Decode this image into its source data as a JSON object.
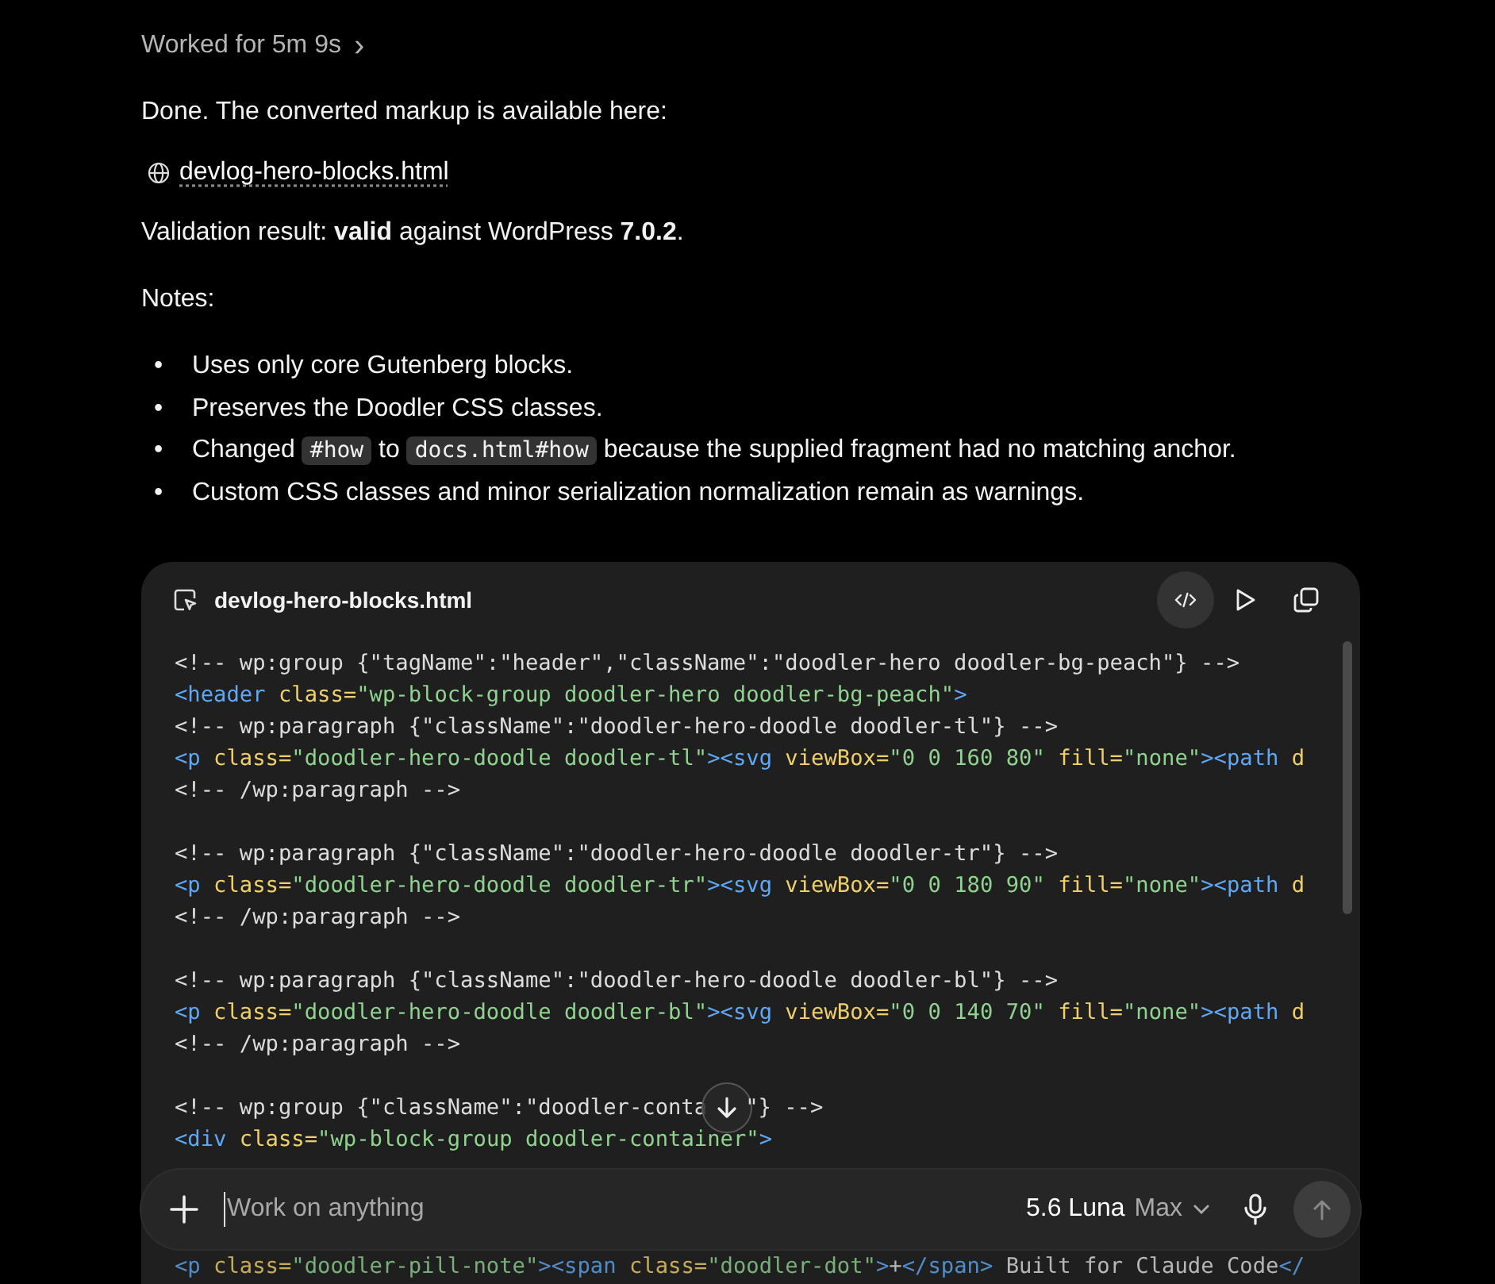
{
  "status": {
    "label": "Worked for 5m 9s",
    "chevron": "›"
  },
  "message": {
    "intro": "Done. The converted markup is available here:",
    "link": "devlog-hero-blocks.html",
    "validation": "Validation result: **valid** against WordPress **7.0.2**.",
    "notes_label": "Notes:",
    "notes": [
      {
        "bullet": "•",
        "parts": [
          {
            "kind": "text",
            "text": "Uses only core Gutenberg blocks."
          }
        ]
      },
      {
        "bullet": "•",
        "parts": [
          {
            "kind": "text",
            "text": "Preserves the Doodler CSS classes."
          }
        ]
      },
      {
        "bullet": "•",
        "parts": [
          {
            "kind": "text",
            "text": "Changed "
          },
          {
            "kind": "code",
            "text": "#how"
          },
          {
            "kind": "text",
            "text": " to "
          },
          {
            "kind": "code",
            "text": "docs.html#how"
          },
          {
            "kind": "text",
            "text": " because the supplied fragment had no matching anchor."
          }
        ]
      },
      {
        "bullet": "•",
        "parts": [
          {
            "kind": "text",
            "text": "Custom CSS classes and minor serialization normalization remain as warnings."
          }
        ]
      }
    ]
  },
  "code_card": {
    "filename": "devlog-hero-blocks.html",
    "lines": [
      {
        "kind": "code",
        "tokens": [
          {
            "kind": "comment",
            "text": "<!-- wp:group {\"tagName\":\"header\",\"className\":\"doodler-hero doodler-bg-peach\"} -->"
          }
        ]
      },
      {
        "kind": "code",
        "tokens": [
          {
            "kind": "tag",
            "text": "<header"
          },
          {
            "kind": "attr",
            "text": " class="
          },
          {
            "kind": "string",
            "text": "\"wp-block-group doodler-hero doodler-bg-peach\""
          },
          {
            "kind": "tag",
            "text": ">"
          }
        ]
      },
      {
        "kind": "code",
        "tokens": [
          {
            "kind": "comment",
            "text": "<!-- wp:paragraph {\"className\":\"doodler-hero-doodle doodler-tl\"} -->"
          }
        ]
      },
      {
        "kind": "code",
        "tokens": [
          {
            "kind": "tag",
            "text": "<p"
          },
          {
            "kind": "attr",
            "text": " class="
          },
          {
            "kind": "string",
            "text": "\"doodler-hero-doodle doodler-tl\""
          },
          {
            "kind": "tag",
            "text": "><svg"
          },
          {
            "kind": "attr",
            "text": " viewBox="
          },
          {
            "kind": "string",
            "text": "\"0 0 160 80\""
          },
          {
            "kind": "attr",
            "text": " fill="
          },
          {
            "kind": "string",
            "text": "\"none\""
          },
          {
            "kind": "tag",
            "text": "><path"
          },
          {
            "kind": "attr",
            "text": " d"
          }
        ]
      },
      {
        "kind": "code",
        "tokens": [
          {
            "kind": "comment",
            "text": "<!-- /wp:paragraph -->"
          }
        ]
      },
      {
        "kind": "blank"
      },
      {
        "kind": "code",
        "tokens": [
          {
            "kind": "comment",
            "text": "<!-- wp:paragraph {\"className\":\"doodler-hero-doodle doodler-tr\"} -->"
          }
        ]
      },
      {
        "kind": "code",
        "tokens": [
          {
            "kind": "tag",
            "text": "<p"
          },
          {
            "kind": "attr",
            "text": " class="
          },
          {
            "kind": "string",
            "text": "\"doodler-hero-doodle doodler-tr\""
          },
          {
            "kind": "tag",
            "text": "><svg"
          },
          {
            "kind": "attr",
            "text": " viewBox="
          },
          {
            "kind": "string",
            "text": "\"0 0 180 90\""
          },
          {
            "kind": "attr",
            "text": " fill="
          },
          {
            "kind": "string",
            "text": "\"none\""
          },
          {
            "kind": "tag",
            "text": "><path"
          },
          {
            "kind": "attr",
            "text": " d"
          }
        ]
      },
      {
        "kind": "code",
        "tokens": [
          {
            "kind": "comment",
            "text": "<!-- /wp:paragraph -->"
          }
        ]
      },
      {
        "kind": "blank"
      },
      {
        "kind": "code",
        "tokens": [
          {
            "kind": "comment",
            "text": "<!-- wp:paragraph {\"className\":\"doodler-hero-doodle doodler-bl\"} -->"
          }
        ]
      },
      {
        "kind": "code",
        "tokens": [
          {
            "kind": "tag",
            "text": "<p"
          },
          {
            "kind": "attr",
            "text": " class="
          },
          {
            "kind": "string",
            "text": "\"doodler-hero-doodle doodler-bl\""
          },
          {
            "kind": "tag",
            "text": "><svg"
          },
          {
            "kind": "attr",
            "text": " viewBox="
          },
          {
            "kind": "string",
            "text": "\"0 0 140 70\""
          },
          {
            "kind": "attr",
            "text": " fill="
          },
          {
            "kind": "string",
            "text": "\"none\""
          },
          {
            "kind": "tag",
            "text": "><path"
          },
          {
            "kind": "attr",
            "text": " d"
          }
        ]
      },
      {
        "kind": "code",
        "tokens": [
          {
            "kind": "comment",
            "text": "<!-- /wp:paragraph -->"
          }
        ]
      },
      {
        "kind": "blank"
      },
      {
        "kind": "code",
        "tokens": [
          {
            "kind": "comment",
            "text": "<!-- wp:group {\"className\":\"doodler-conta"
          },
          {
            "kind": "scroll-button"
          },
          {
            "kind": "comment",
            "text": "\"} -->"
          }
        ]
      },
      {
        "kind": "code",
        "tokens": [
          {
            "kind": "tag",
            "text": "<div"
          },
          {
            "kind": "attr",
            "text": " class="
          },
          {
            "kind": "string",
            "text": "\"wp-block-group doodler-container\""
          },
          {
            "kind": "tag",
            "text": ">"
          }
        ]
      },
      {
        "kind": "covered"
      },
      {
        "kind": "covered"
      },
      {
        "kind": "covered"
      },
      {
        "kind": "dim",
        "tokens": [
          {
            "kind": "tag",
            "text": "<p"
          },
          {
            "kind": "attr",
            "text": " class="
          },
          {
            "kind": "string",
            "text": "\"doodler-pill-note\""
          },
          {
            "kind": "tag",
            "text": "><span"
          },
          {
            "kind": "attr",
            "text": " class="
          },
          {
            "kind": "string",
            "text": "\"doodler-dot\""
          },
          {
            "kind": "tag",
            "text": ">"
          },
          {
            "kind": "plain",
            "text": "+"
          },
          {
            "kind": "tag",
            "text": "</span>"
          },
          {
            "kind": "plain",
            "text": " Built for Claude Code"
          },
          {
            "kind": "tag",
            "text": "</"
          }
        ]
      }
    ]
  },
  "composer": {
    "placeholder": "Work on anything",
    "model": "5.6 Luna",
    "effort": "Max"
  }
}
